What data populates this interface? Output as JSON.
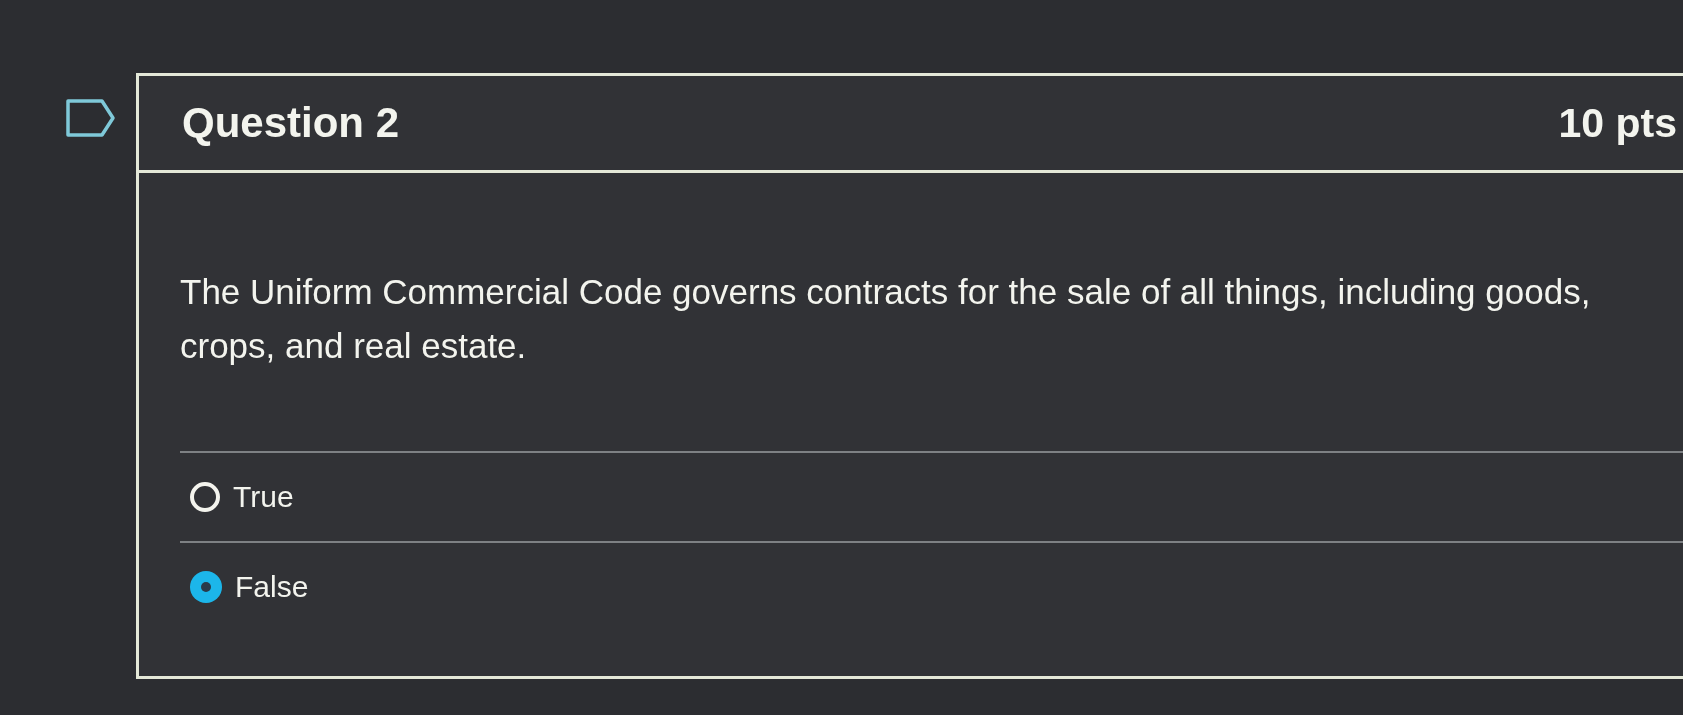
{
  "question": {
    "flagged": false,
    "title": "Question 2",
    "points": "10 pts",
    "text": "The Uniform Commercial Code governs contracts for the sale of all things, including goods, crops, and real estate.",
    "answers": [
      {
        "label": "True",
        "selected": false
      },
      {
        "label": "False",
        "selected": true
      }
    ]
  }
}
